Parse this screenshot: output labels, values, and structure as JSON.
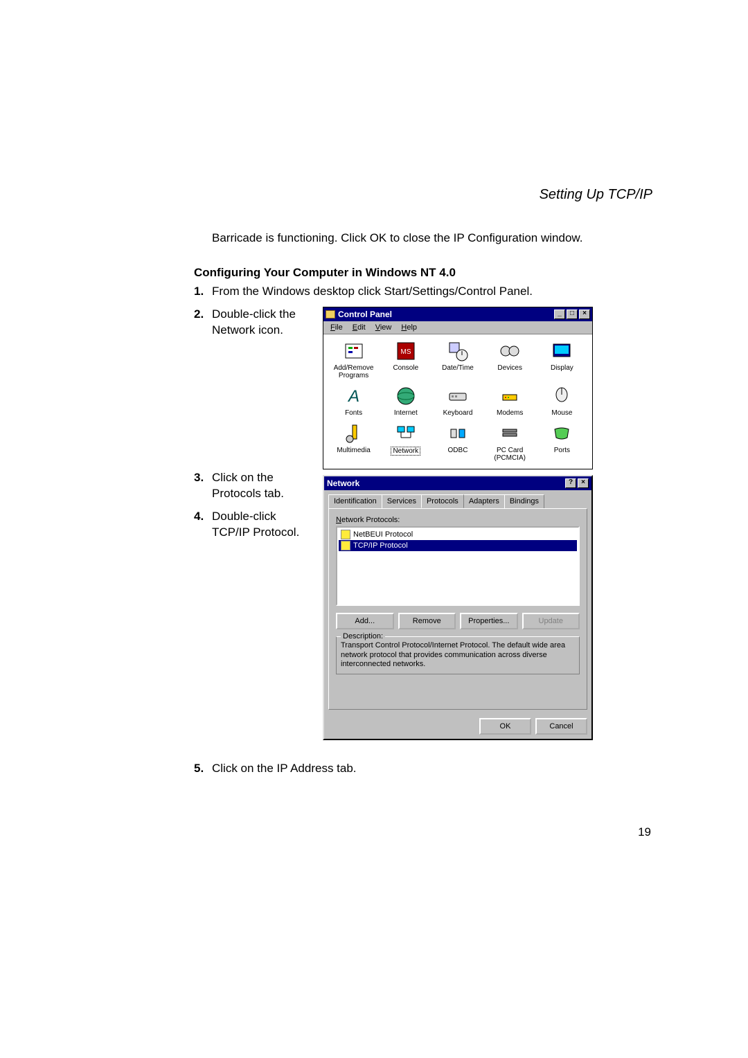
{
  "header": {
    "title": "Setting Up TCP/IP"
  },
  "intro": "Barricade is functioning. Click OK to close the IP Configuration window.",
  "section_heading": "Configuring Your Computer in Windows NT 4.0",
  "steps": {
    "s1_num": "1.",
    "s1_text": "From the Windows desktop click Start/Settings/Control Panel.",
    "s2_num": "2.",
    "s2_text": "Double-click the Network icon.",
    "s3_num": "3.",
    "s3_text": "Click on the Protocols tab.",
    "s4_num": "4.",
    "s4_text": "Double-click TCP/IP Protocol.",
    "s5_num": "5.",
    "s5_text": "Click on the IP Address tab."
  },
  "control_panel": {
    "title": "Control Panel",
    "menus": {
      "file": "File",
      "edit": "Edit",
      "view": "View",
      "help": "Help"
    },
    "items": [
      {
        "label": "Add/Remove\nPrograms"
      },
      {
        "label": "Console"
      },
      {
        "label": "Date/Time"
      },
      {
        "label": "Devices"
      },
      {
        "label": "Display"
      },
      {
        "label": "Fonts"
      },
      {
        "label": "Internet"
      },
      {
        "label": "Keyboard"
      },
      {
        "label": "Modems"
      },
      {
        "label": "Mouse"
      },
      {
        "label": "Multimedia"
      },
      {
        "label": "Network"
      },
      {
        "label": "ODBC"
      },
      {
        "label": "PC Card\n(PCMCIA)"
      },
      {
        "label": "Ports"
      }
    ],
    "selected_index": 11
  },
  "network_dialog": {
    "title": "Network",
    "tabs": {
      "identification": "Identification",
      "services": "Services",
      "protocols": "Protocols",
      "adapters": "Adapters",
      "bindings": "Bindings"
    },
    "list_label": "Network Protocols:",
    "list_items": [
      {
        "text": "NetBEUI Protocol",
        "selected": false
      },
      {
        "text": "TCP/IP Protocol",
        "selected": true
      }
    ],
    "buttons": {
      "add": "Add...",
      "remove": "Remove",
      "properties": "Properties...",
      "update": "Update"
    },
    "description_label": "Description:",
    "description_text": "Transport Control Protocol/Internet Protocol. The default wide area network protocol that provides communication across diverse interconnected networks.",
    "ok": "OK",
    "cancel": "Cancel"
  },
  "page_number": "19"
}
